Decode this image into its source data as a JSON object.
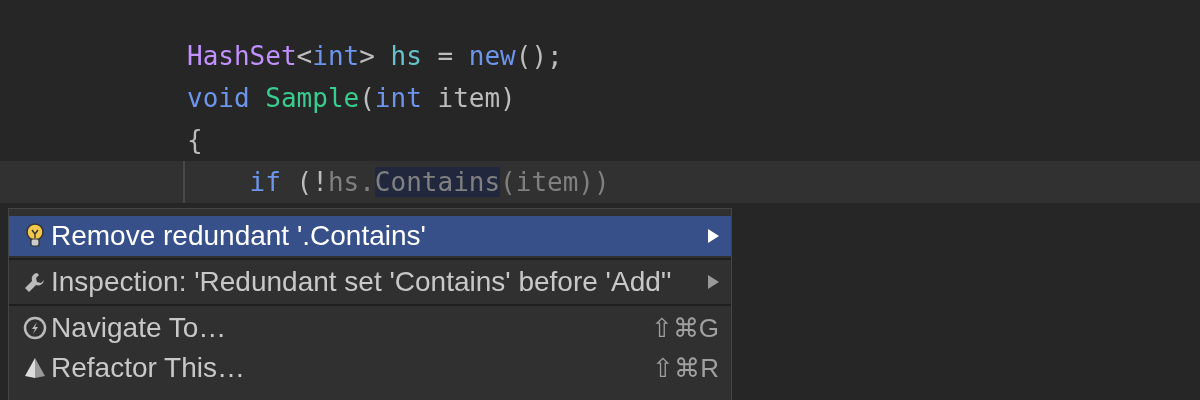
{
  "editor": {
    "lines": [
      {
        "current": false,
        "tokens": [
          {
            "text": "HashSet",
            "kind": "type"
          },
          {
            "text": "<",
            "kind": "plain"
          },
          {
            "text": "int",
            "kind": "keyword"
          },
          {
            "text": "> ",
            "kind": "plain"
          },
          {
            "text": "hs",
            "kind": "field"
          },
          {
            "text": " = ",
            "kind": "plain"
          },
          {
            "text": "new",
            "kind": "keyword"
          },
          {
            "text": "();",
            "kind": "plain"
          }
        ]
      },
      {
        "current": false,
        "tokens": [
          {
            "text": "void",
            "kind": "keyword"
          },
          {
            "text": " Sample",
            "kind": "method"
          },
          {
            "text": "(",
            "kind": "plain"
          },
          {
            "text": "int",
            "kind": "keyword"
          },
          {
            "text": " item)",
            "kind": "plain"
          }
        ]
      },
      {
        "current": false,
        "tokens": [
          {
            "text": "{",
            "kind": "plain"
          }
        ]
      },
      {
        "current": true,
        "tokens": [
          {
            "text": "    if",
            "kind": "keyword"
          },
          {
            "text": " (!",
            "kind": "plain"
          },
          {
            "text": "hs.",
            "kind": "dim"
          },
          {
            "text": "Contains",
            "kind": "dim",
            "highlighted": true
          },
          {
            "text": "(item))",
            "kind": "dim"
          }
        ]
      }
    ]
  },
  "menu": {
    "items": [
      {
        "label": "Remove redundant '.Contains'",
        "selected": true,
        "submenu": true,
        "separator_after": true
      },
      {
        "label": "Inspection: 'Redundant set 'Contains' before 'Add''",
        "selected": false,
        "submenu": true,
        "separator_after": true
      },
      {
        "label": "Navigate To…",
        "shortcut": "⇧⌘G",
        "selected": false,
        "submenu": false,
        "separator_after": false
      },
      {
        "label": "Refactor This…",
        "shortcut": "⇧⌘R",
        "selected": false,
        "submenu": false,
        "separator_after": false
      }
    ]
  }
}
